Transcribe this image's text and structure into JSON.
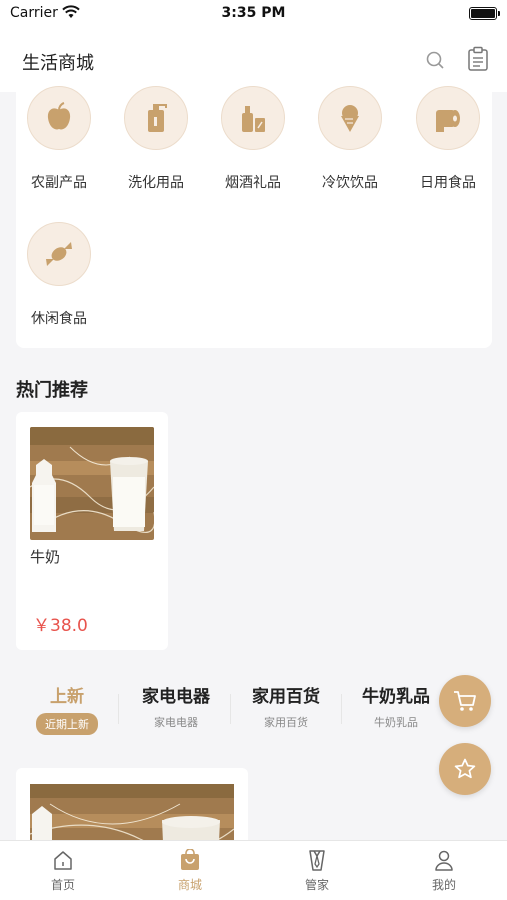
{
  "status_bar": {
    "carrier": "Carrier",
    "time": "3:35 PM"
  },
  "nav": {
    "title": "生活商城",
    "icons": [
      "search-icon",
      "clipboard-icon"
    ]
  },
  "categories": [
    {
      "label": "农副产品",
      "icon": "apple-icon"
    },
    {
      "label": "洗化用品",
      "icon": "bottle-icon"
    },
    {
      "label": "烟酒礼品",
      "icon": "liquor-icon"
    },
    {
      "label": "冷饮饮品",
      "icon": "ice-cream-icon"
    },
    {
      "label": "日用食品",
      "icon": "tissue-roll-icon"
    },
    {
      "label": "休闲食品",
      "icon": "candy-icon"
    }
  ],
  "hot": {
    "title": "热门推荐",
    "products": [
      {
        "name": "牛奶",
        "price": "￥38.0",
        "image": "milk-photo"
      }
    ]
  },
  "tabs": [
    {
      "title": "上新",
      "subtitle": "近期上新",
      "active": true
    },
    {
      "title": "家电电器",
      "subtitle": "家电电器",
      "active": false
    },
    {
      "title": "家用百货",
      "subtitle": "家用百货",
      "active": false
    },
    {
      "title": "牛奶乳品",
      "subtitle": "牛奶乳品",
      "active": false
    }
  ],
  "floating": {
    "cart": "cart-icon",
    "favorite": "star-icon"
  },
  "tabbar": [
    {
      "label": "首页",
      "icon": "home-icon",
      "active": false
    },
    {
      "label": "商城",
      "icon": "shopping-bag-icon",
      "active": true
    },
    {
      "label": "管家",
      "icon": "butler-icon",
      "active": false
    },
    {
      "label": "我的",
      "icon": "user-icon",
      "active": false
    }
  ],
  "colors": {
    "accent": "#c8a16d",
    "price": "#e8544d",
    "category_bg": "#f7ede3"
  }
}
